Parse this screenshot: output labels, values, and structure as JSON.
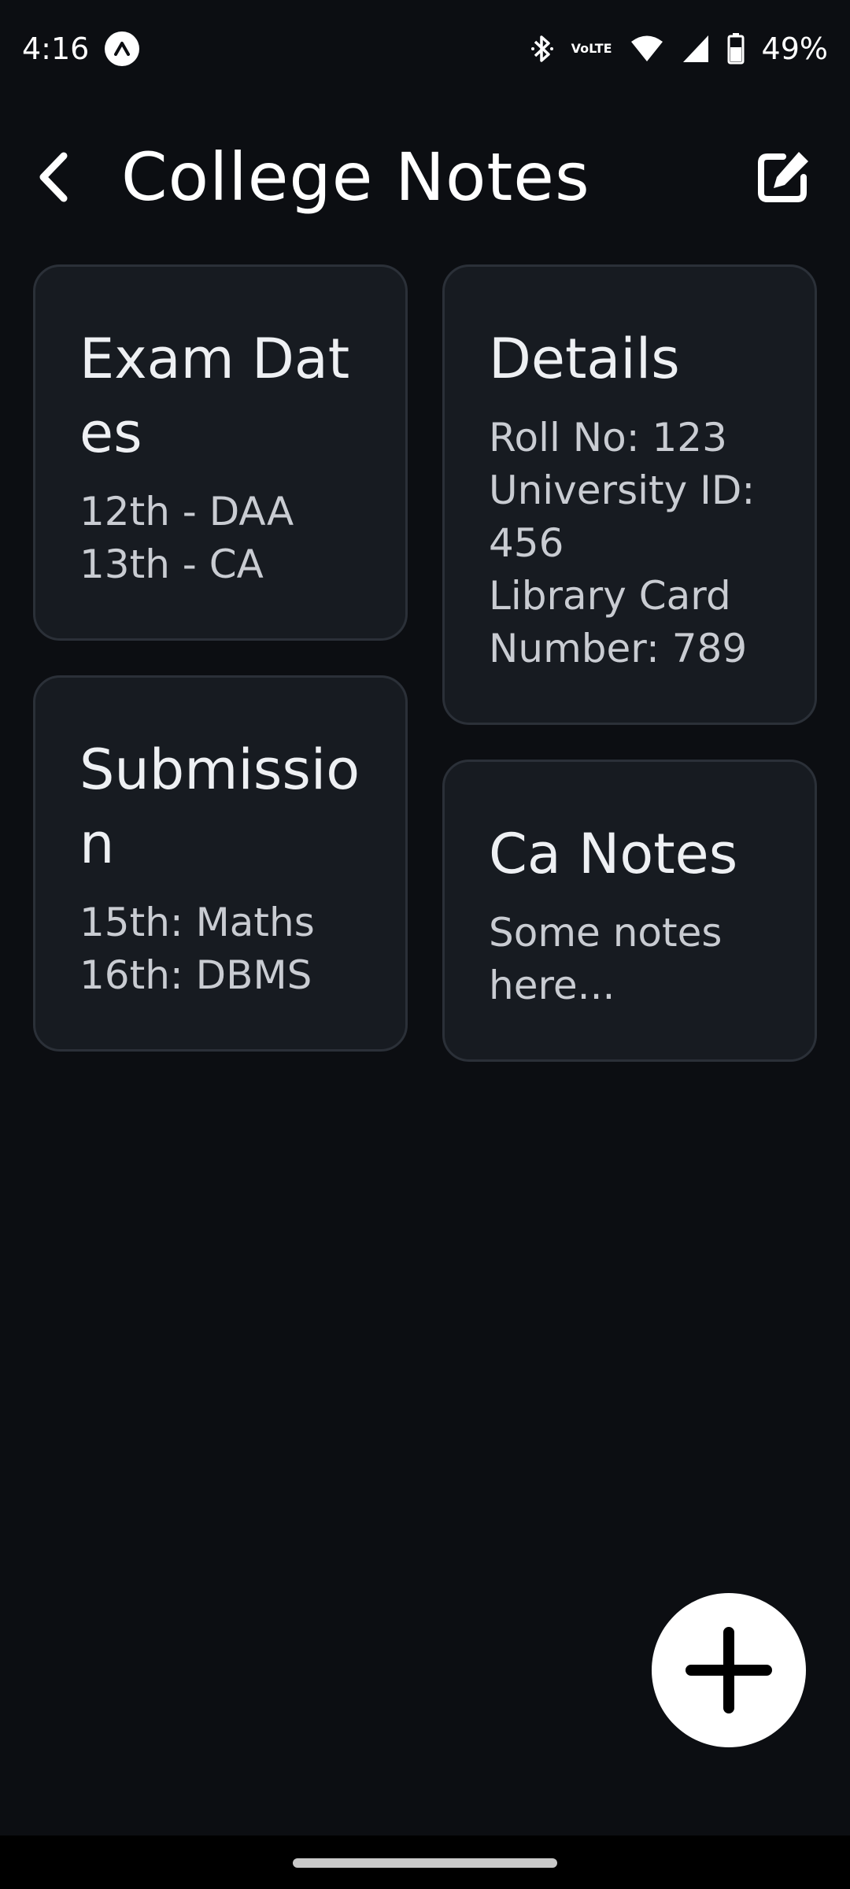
{
  "status_bar": {
    "time": "4:16",
    "volte_top": "Vo",
    "volte_bottom": "LTE",
    "battery": "49%"
  },
  "header": {
    "title": "College Notes"
  },
  "notes": [
    {
      "title": "Exam Dates",
      "body": "12th - DAA\n13th - CA"
    },
    {
      "title": "Submission",
      "body": "15th: Maths\n16th: DBMS"
    },
    {
      "title": "Details",
      "body": "Roll No: 123\nUniversity ID: 456\nLibrary Card Number: 789"
    },
    {
      "title": "Ca Notes",
      "body": "Some notes here..."
    }
  ],
  "colors": {
    "background": "#0c0e12",
    "card": "#171b21",
    "card_border": "#2b3038",
    "fab": "#ffffff"
  }
}
